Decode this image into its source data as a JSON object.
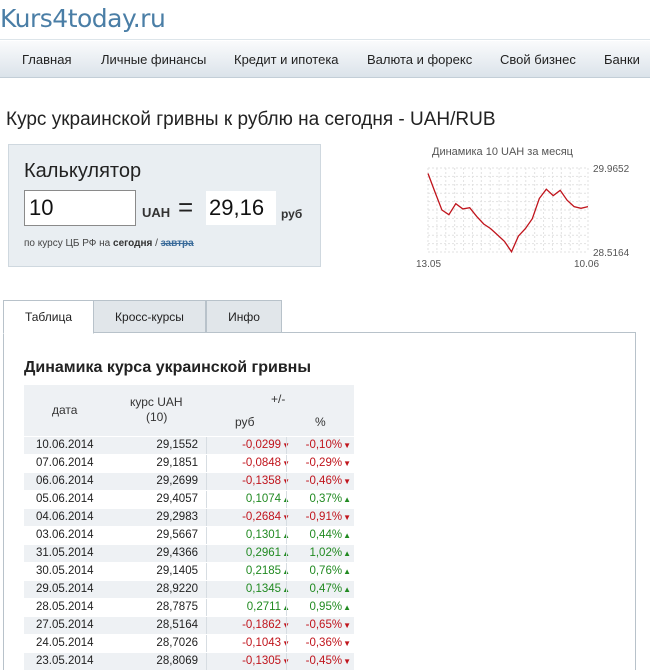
{
  "site": {
    "logo": "Kurs4today.ru"
  },
  "nav": [
    {
      "label": "Главная"
    },
    {
      "label": "Личные финансы"
    },
    {
      "label": "Кредит и ипотека"
    },
    {
      "label": "Валюта и форекс"
    },
    {
      "label": "Свой бизнес"
    },
    {
      "label": "Банки"
    }
  ],
  "page": {
    "title": "Курс украинской гривны к рублю на сегодня - UAH/RUB"
  },
  "calculator": {
    "title": "Калькулятор",
    "input_value": "10",
    "from_unit": "UAH",
    "equals": "=",
    "result": "29,16",
    "to_unit": "руб",
    "note_prefix": "по курсу ЦБ РФ на",
    "note_today": "сегодня",
    "note_sep": "/",
    "note_tomorrow": "завтра"
  },
  "chart_data": {
    "type": "line",
    "title": "Динамика 10 UAH за месяц",
    "x_start_label": "13.05",
    "x_end_label": "10.06",
    "y_max_label": "29.9652",
    "y_min_label": "28.5164",
    "ylim": [
      28.5164,
      29.9652
    ],
    "grid": true,
    "line_color": "#c0141c",
    "values": [
      29.87,
      29.55,
      29.24,
      29.16,
      29.35,
      29.26,
      29.28,
      29.13,
      29.0,
      28.92,
      28.81,
      28.7,
      28.52,
      28.79,
      28.92,
      29.09,
      29.44,
      29.6,
      29.49,
      29.58,
      29.41,
      29.3,
      29.27,
      29.3
    ]
  },
  "tabs": [
    {
      "label": "Таблица",
      "active": true
    },
    {
      "label": "Кросс-курсы",
      "active": false
    },
    {
      "label": "Инфо",
      "active": false
    }
  ],
  "table": {
    "title": "Динамика курса украинской гривны",
    "headers": {
      "date": "дата",
      "rate_line1": "курс UAH",
      "rate_line2": "(10)",
      "change": "+/-",
      "abs": "руб",
      "pct": "%"
    },
    "rows": [
      {
        "date": "10.06.2014",
        "rate": "29,1552",
        "abs": "-0,0299",
        "pct": "-0,10%",
        "dir": "down"
      },
      {
        "date": "07.06.2014",
        "rate": "29,1851",
        "abs": "-0,0848",
        "pct": "-0,29%",
        "dir": "down"
      },
      {
        "date": "06.06.2014",
        "rate": "29,2699",
        "abs": "-0,1358",
        "pct": "-0,46%",
        "dir": "down"
      },
      {
        "date": "05.06.2014",
        "rate": "29,4057",
        "abs": "0,1074",
        "pct": "0,37%",
        "dir": "up"
      },
      {
        "date": "04.06.2014",
        "rate": "29,2983",
        "abs": "-0,2684",
        "pct": "-0,91%",
        "dir": "down"
      },
      {
        "date": "03.06.2014",
        "rate": "29,5667",
        "abs": "0,1301",
        "pct": "0,44%",
        "dir": "up"
      },
      {
        "date": "31.05.2014",
        "rate": "29,4366",
        "abs": "0,2961",
        "pct": "1,02%",
        "dir": "up"
      },
      {
        "date": "30.05.2014",
        "rate": "29,1405",
        "abs": "0,2185",
        "pct": "0,76%",
        "dir": "up"
      },
      {
        "date": "29.05.2014",
        "rate": "28,9220",
        "abs": "0,1345",
        "pct": "0,47%",
        "dir": "up"
      },
      {
        "date": "28.05.2014",
        "rate": "28,7875",
        "abs": "0,2711",
        "pct": "0,95%",
        "dir": "up"
      },
      {
        "date": "27.05.2014",
        "rate": "28,5164",
        "abs": "-0,1862",
        "pct": "-0,65%",
        "dir": "down"
      },
      {
        "date": "24.05.2014",
        "rate": "28,7026",
        "abs": "-0,1043",
        "pct": "-0,36%",
        "dir": "down"
      },
      {
        "date": "23.05.2014",
        "rate": "28,8069",
        "abs": "-0,1305",
        "pct": "-0,45%",
        "dir": "down"
      }
    ]
  }
}
